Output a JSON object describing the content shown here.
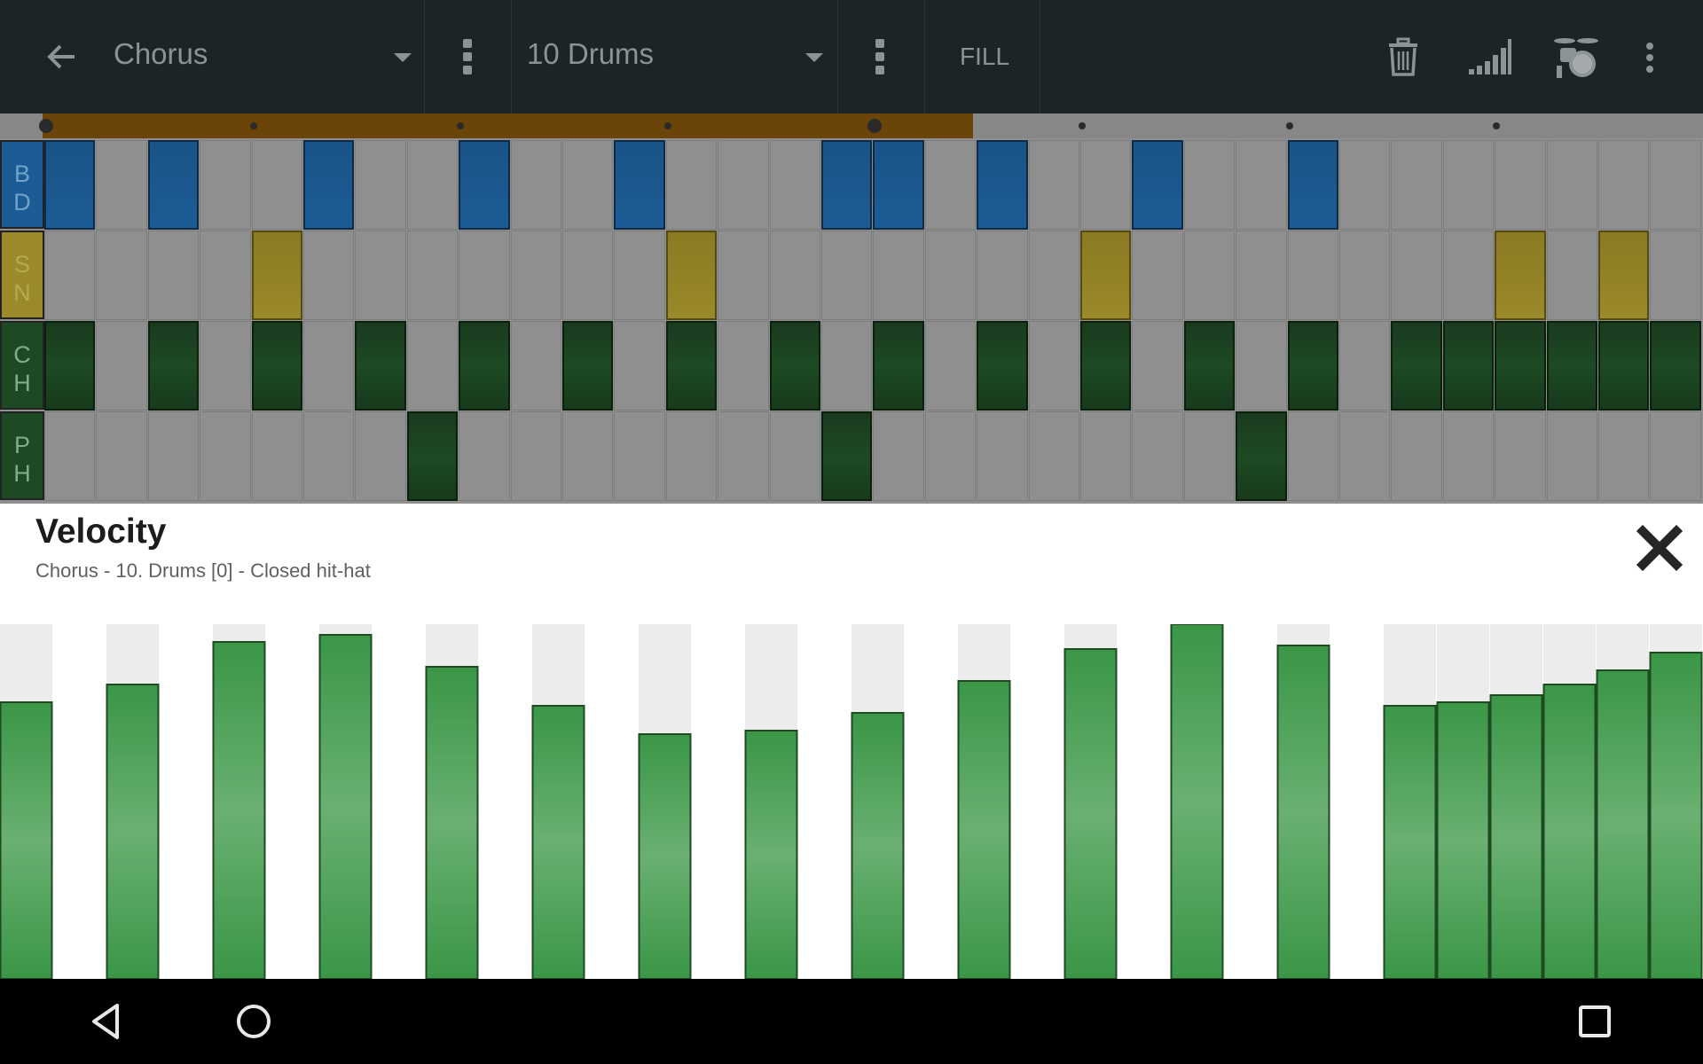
{
  "toolbar": {
    "back_icon": "arrow-left-icon",
    "section_select": "Chorus",
    "track_select": "10 Drums",
    "fill_label": "FILL",
    "icons": [
      "trash-icon",
      "velocity-bars-icon",
      "drum-kit-icon",
      "more-vert-icon"
    ]
  },
  "sequencer": {
    "rows": [
      {
        "label": [
          "B",
          "D"
        ],
        "label_color": "#1c5c96",
        "steps": [
          1,
          0,
          1,
          0,
          0,
          1,
          0,
          0,
          1,
          0,
          0,
          1,
          0,
          0,
          0,
          1,
          1,
          0,
          1,
          0,
          0,
          1,
          0,
          0,
          1,
          0,
          0,
          0,
          0,
          0,
          0,
          0
        ]
      },
      {
        "label": [
          "S",
          "N"
        ],
        "label_color": "#9a8a2a",
        "steps": [
          0,
          0,
          0,
          0,
          1,
          0,
          0,
          0,
          0,
          0,
          0,
          0,
          1,
          0,
          0,
          0,
          0,
          0,
          0,
          0,
          1,
          0,
          0,
          0,
          0,
          0,
          0,
          0,
          1,
          0,
          1,
          0
        ]
      },
      {
        "label": [
          "C",
          "H"
        ],
        "label_color": "#1d4a24",
        "steps": [
          1,
          0,
          1,
          0,
          1,
          0,
          1,
          0,
          1,
          0,
          1,
          0,
          1,
          0,
          1,
          0,
          1,
          0,
          1,
          0,
          1,
          0,
          1,
          0,
          1,
          0,
          1,
          1,
          1,
          1,
          1,
          1
        ]
      },
      {
        "label": [
          "P",
          "H"
        ],
        "label_color": "#1d4a24",
        "steps": [
          0,
          0,
          0,
          0,
          0,
          0,
          0,
          1,
          0,
          0,
          0,
          0,
          0,
          0,
          0,
          1,
          0,
          0,
          0,
          0,
          0,
          0,
          0,
          1,
          0,
          0,
          0,
          0,
          0,
          0,
          0,
          0
        ]
      }
    ],
    "playback_progress": 0.53
  },
  "velocity": {
    "title": "Velocity",
    "subtitle": "Chorus - 10. Drums [0] - Closed hit-hat",
    "close_icon": "close-icon",
    "bar_color": "#3f9c48",
    "values": [
      0.78,
      null,
      0.83,
      null,
      0.95,
      null,
      0.97,
      null,
      0.88,
      null,
      0.77,
      null,
      0.69,
      null,
      0.7,
      null,
      0.75,
      null,
      0.84,
      null,
      0.93,
      null,
      1.0,
      null,
      0.94,
      null,
      0.77,
      0.78,
      0.8,
      0.83,
      0.87,
      0.92
    ]
  },
  "navbar": {
    "icons": [
      "nav-back-icon",
      "nav-home-icon",
      "nav-recents-icon"
    ]
  }
}
